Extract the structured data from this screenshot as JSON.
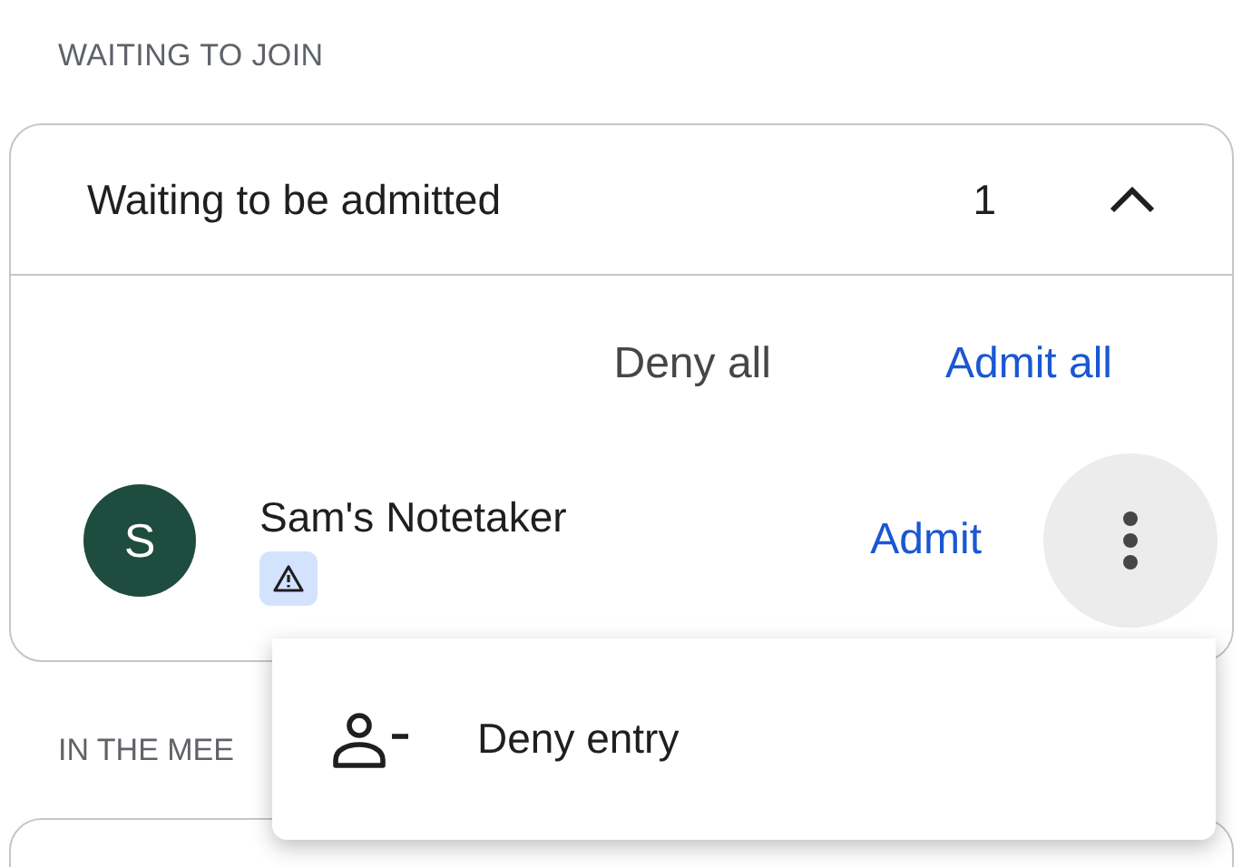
{
  "waiting_section": {
    "label": "WAITING TO JOIN"
  },
  "waiting_panel": {
    "title": "Waiting to be admitted",
    "count": "1",
    "expanded": true,
    "actions": [
      {
        "label": "Deny all",
        "kind": "secondary"
      },
      {
        "label": "Admit all",
        "kind": "primary"
      }
    ],
    "participants": [
      {
        "initial": "S",
        "name": "Sam's Notetaker",
        "color": "#1e4d3f",
        "warning": true,
        "admit_label": "Admit"
      }
    ]
  },
  "menu": {
    "items": [
      {
        "label": "Deny entry"
      }
    ]
  },
  "meeting_section": {
    "label": "IN THE MEE"
  }
}
